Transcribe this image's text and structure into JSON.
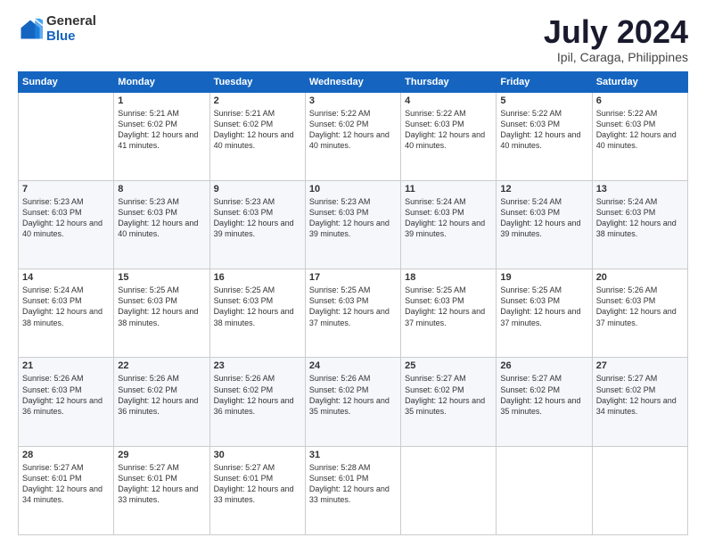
{
  "logo": {
    "general": "General",
    "blue": "Blue"
  },
  "title": "July 2024",
  "subtitle": "Ipil, Caraga, Philippines",
  "days_of_week": [
    "Sunday",
    "Monday",
    "Tuesday",
    "Wednesday",
    "Thursday",
    "Friday",
    "Saturday"
  ],
  "weeks": [
    [
      {
        "day": "",
        "sunrise": "",
        "sunset": "",
        "daylight": ""
      },
      {
        "day": "1",
        "sunrise": "Sunrise: 5:21 AM",
        "sunset": "Sunset: 6:02 PM",
        "daylight": "Daylight: 12 hours and 41 minutes."
      },
      {
        "day": "2",
        "sunrise": "Sunrise: 5:21 AM",
        "sunset": "Sunset: 6:02 PM",
        "daylight": "Daylight: 12 hours and 40 minutes."
      },
      {
        "day": "3",
        "sunrise": "Sunrise: 5:22 AM",
        "sunset": "Sunset: 6:02 PM",
        "daylight": "Daylight: 12 hours and 40 minutes."
      },
      {
        "day": "4",
        "sunrise": "Sunrise: 5:22 AM",
        "sunset": "Sunset: 6:03 PM",
        "daylight": "Daylight: 12 hours and 40 minutes."
      },
      {
        "day": "5",
        "sunrise": "Sunrise: 5:22 AM",
        "sunset": "Sunset: 6:03 PM",
        "daylight": "Daylight: 12 hours and 40 minutes."
      },
      {
        "day": "6",
        "sunrise": "Sunrise: 5:22 AM",
        "sunset": "Sunset: 6:03 PM",
        "daylight": "Daylight: 12 hours and 40 minutes."
      }
    ],
    [
      {
        "day": "7",
        "sunrise": "Sunrise: 5:23 AM",
        "sunset": "Sunset: 6:03 PM",
        "daylight": "Daylight: 12 hours and 40 minutes."
      },
      {
        "day": "8",
        "sunrise": "Sunrise: 5:23 AM",
        "sunset": "Sunset: 6:03 PM",
        "daylight": "Daylight: 12 hours and 40 minutes."
      },
      {
        "day": "9",
        "sunrise": "Sunrise: 5:23 AM",
        "sunset": "Sunset: 6:03 PM",
        "daylight": "Daylight: 12 hours and 39 minutes."
      },
      {
        "day": "10",
        "sunrise": "Sunrise: 5:23 AM",
        "sunset": "Sunset: 6:03 PM",
        "daylight": "Daylight: 12 hours and 39 minutes."
      },
      {
        "day": "11",
        "sunrise": "Sunrise: 5:24 AM",
        "sunset": "Sunset: 6:03 PM",
        "daylight": "Daylight: 12 hours and 39 minutes."
      },
      {
        "day": "12",
        "sunrise": "Sunrise: 5:24 AM",
        "sunset": "Sunset: 6:03 PM",
        "daylight": "Daylight: 12 hours and 39 minutes."
      },
      {
        "day": "13",
        "sunrise": "Sunrise: 5:24 AM",
        "sunset": "Sunset: 6:03 PM",
        "daylight": "Daylight: 12 hours and 38 minutes."
      }
    ],
    [
      {
        "day": "14",
        "sunrise": "Sunrise: 5:24 AM",
        "sunset": "Sunset: 6:03 PM",
        "daylight": "Daylight: 12 hours and 38 minutes."
      },
      {
        "day": "15",
        "sunrise": "Sunrise: 5:25 AM",
        "sunset": "Sunset: 6:03 PM",
        "daylight": "Daylight: 12 hours and 38 minutes."
      },
      {
        "day": "16",
        "sunrise": "Sunrise: 5:25 AM",
        "sunset": "Sunset: 6:03 PM",
        "daylight": "Daylight: 12 hours and 38 minutes."
      },
      {
        "day": "17",
        "sunrise": "Sunrise: 5:25 AM",
        "sunset": "Sunset: 6:03 PM",
        "daylight": "Daylight: 12 hours and 37 minutes."
      },
      {
        "day": "18",
        "sunrise": "Sunrise: 5:25 AM",
        "sunset": "Sunset: 6:03 PM",
        "daylight": "Daylight: 12 hours and 37 minutes."
      },
      {
        "day": "19",
        "sunrise": "Sunrise: 5:25 AM",
        "sunset": "Sunset: 6:03 PM",
        "daylight": "Daylight: 12 hours and 37 minutes."
      },
      {
        "day": "20",
        "sunrise": "Sunrise: 5:26 AM",
        "sunset": "Sunset: 6:03 PM",
        "daylight": "Daylight: 12 hours and 37 minutes."
      }
    ],
    [
      {
        "day": "21",
        "sunrise": "Sunrise: 5:26 AM",
        "sunset": "Sunset: 6:03 PM",
        "daylight": "Daylight: 12 hours and 36 minutes."
      },
      {
        "day": "22",
        "sunrise": "Sunrise: 5:26 AM",
        "sunset": "Sunset: 6:02 PM",
        "daylight": "Daylight: 12 hours and 36 minutes."
      },
      {
        "day": "23",
        "sunrise": "Sunrise: 5:26 AM",
        "sunset": "Sunset: 6:02 PM",
        "daylight": "Daylight: 12 hours and 36 minutes."
      },
      {
        "day": "24",
        "sunrise": "Sunrise: 5:26 AM",
        "sunset": "Sunset: 6:02 PM",
        "daylight": "Daylight: 12 hours and 35 minutes."
      },
      {
        "day": "25",
        "sunrise": "Sunrise: 5:27 AM",
        "sunset": "Sunset: 6:02 PM",
        "daylight": "Daylight: 12 hours and 35 minutes."
      },
      {
        "day": "26",
        "sunrise": "Sunrise: 5:27 AM",
        "sunset": "Sunset: 6:02 PM",
        "daylight": "Daylight: 12 hours and 35 minutes."
      },
      {
        "day": "27",
        "sunrise": "Sunrise: 5:27 AM",
        "sunset": "Sunset: 6:02 PM",
        "daylight": "Daylight: 12 hours and 34 minutes."
      }
    ],
    [
      {
        "day": "28",
        "sunrise": "Sunrise: 5:27 AM",
        "sunset": "Sunset: 6:01 PM",
        "daylight": "Daylight: 12 hours and 34 minutes."
      },
      {
        "day": "29",
        "sunrise": "Sunrise: 5:27 AM",
        "sunset": "Sunset: 6:01 PM",
        "daylight": "Daylight: 12 hours and 33 minutes."
      },
      {
        "day": "30",
        "sunrise": "Sunrise: 5:27 AM",
        "sunset": "Sunset: 6:01 PM",
        "daylight": "Daylight: 12 hours and 33 minutes."
      },
      {
        "day": "31",
        "sunrise": "Sunrise: 5:28 AM",
        "sunset": "Sunset: 6:01 PM",
        "daylight": "Daylight: 12 hours and 33 minutes."
      },
      {
        "day": "",
        "sunrise": "",
        "sunset": "",
        "daylight": ""
      },
      {
        "day": "",
        "sunrise": "",
        "sunset": "",
        "daylight": ""
      },
      {
        "day": "",
        "sunrise": "",
        "sunset": "",
        "daylight": ""
      }
    ]
  ]
}
